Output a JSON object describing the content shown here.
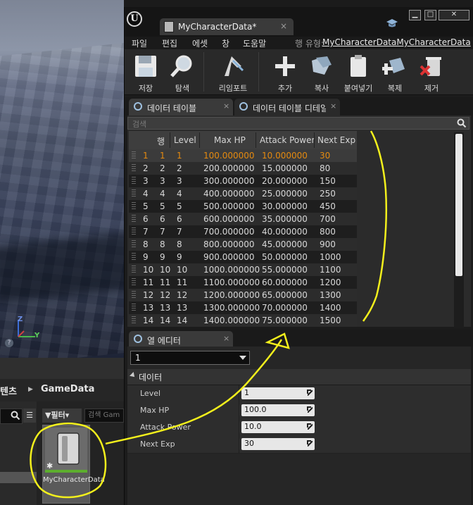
{
  "content_browser": {
    "path_crumb": "텐츠",
    "folder": "GameData",
    "filter_label": "필터",
    "search_placeholder": "검색 Gam",
    "asset": {
      "name": "MyCharacterData"
    }
  },
  "window": {
    "tab_title": "MyCharacterData*",
    "close_glyph": "×",
    "controls": {
      "minimize": "▁",
      "maximize": "□",
      "close": "✕"
    }
  },
  "menu": {
    "items": [
      "파일",
      "편집",
      "에셋",
      "창",
      "도움말"
    ],
    "row_type_label": "행 유형:",
    "row_type_value": "MyCharacterDataMyCharacterData"
  },
  "toolbar": {
    "save": "저장",
    "browse": "탐색",
    "reimport": "리임포트",
    "add": "추가",
    "copy": "복사",
    "paste": "붙여넣기",
    "duplicate": "복제",
    "remove": "제거"
  },
  "tabs": {
    "data_table": "데이터 테이블",
    "data_table_details": "데이터 테이블 디테일",
    "column_editor": "열 에디터"
  },
  "search": {
    "placeholder": "검색"
  },
  "table": {
    "columns": [
      "행 이름",
      "Level",
      "Max HP",
      "Attack Power",
      "Next Exp"
    ],
    "rows": [
      [
        "1",
        "1",
        "1",
        "100.000000",
        "10.000000",
        "30"
      ],
      [
        "2",
        "2",
        "2",
        "200.000000",
        "15.000000",
        "80"
      ],
      [
        "3",
        "3",
        "3",
        "300.000000",
        "20.000000",
        "150"
      ],
      [
        "4",
        "4",
        "4",
        "400.000000",
        "25.000000",
        "250"
      ],
      [
        "5",
        "5",
        "5",
        "500.000000",
        "30.000000",
        "450"
      ],
      [
        "6",
        "6",
        "6",
        "600.000000",
        "35.000000",
        "700"
      ],
      [
        "7",
        "7",
        "7",
        "700.000000",
        "40.000000",
        "800"
      ],
      [
        "8",
        "8",
        "8",
        "800.000000",
        "45.000000",
        "900"
      ],
      [
        "9",
        "9",
        "9",
        "900.000000",
        "50.000000",
        "1000"
      ],
      [
        "10",
        "10",
        "10",
        "1000.000000",
        "55.000000",
        "1100"
      ],
      [
        "11",
        "11",
        "11",
        "1100.000000",
        "60.000000",
        "1200"
      ],
      [
        "12",
        "12",
        "12",
        "1200.000000",
        "65.000000",
        "1300"
      ],
      [
        "13",
        "13",
        "13",
        "1300.000000",
        "70.000000",
        "1400"
      ],
      [
        "14",
        "14",
        "14",
        "1400.000000",
        "75.000000",
        "1500"
      ]
    ]
  },
  "row_editor": {
    "selected_row": "1",
    "section": "데이터",
    "fields": [
      {
        "label": "Level",
        "value": "1"
      },
      {
        "label": "Max HP",
        "value": "100.0"
      },
      {
        "label": "Attack Power",
        "value": "10.0"
      },
      {
        "label": "Next Exp",
        "value": "30"
      }
    ]
  },
  "axis": {
    "x": "Y",
    "z": "Z"
  },
  "colors": {
    "selected_row_text": "#e58a0f",
    "annotation": "#f3f01c",
    "asset_bar": "#5dae2e"
  }
}
